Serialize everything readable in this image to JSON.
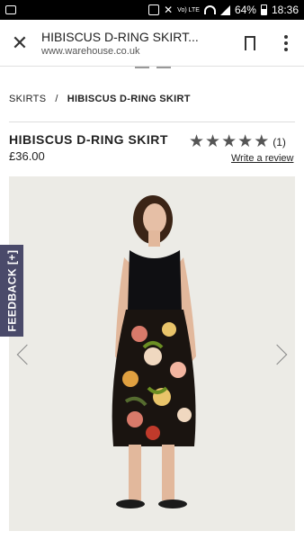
{
  "status_bar": {
    "battery": "64%",
    "time": "18:36",
    "network_label": "Vo) LTE"
  },
  "toolbar": {
    "title": "HIBISCUS D-RING SKIRT...",
    "url": "www.warehouse.co.uk"
  },
  "breadcrumb": {
    "items": [
      "SKIRTS",
      "HIBISCUS D-RING SKIRT"
    ],
    "separator": "/"
  },
  "product": {
    "name": "HIBISCUS D-RING SKIRT",
    "price": "£36.00",
    "rating_stars": 5,
    "review_count": "(1)",
    "write_review": "Write a review"
  },
  "feedback_tab": {
    "label": "FEEDBACK [+]"
  },
  "colors": {
    "feedback_bg": "#4a4a6a",
    "image_bg": "#ecebe6",
    "star": "#555555"
  }
}
